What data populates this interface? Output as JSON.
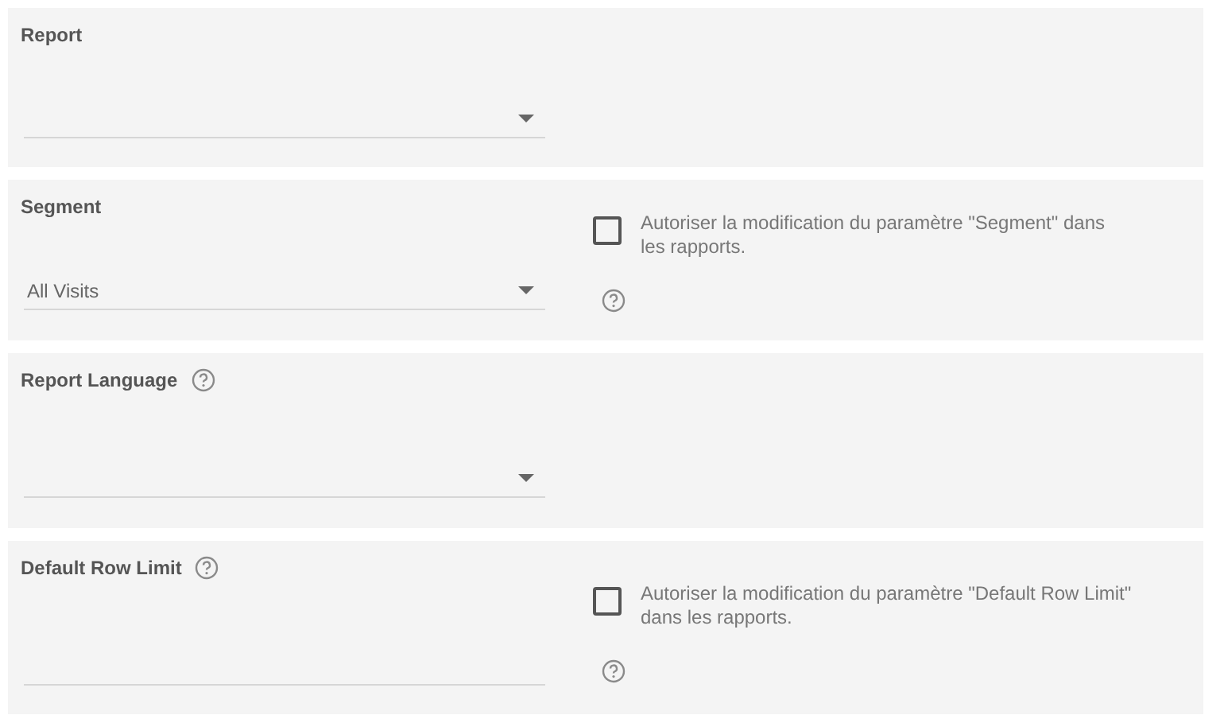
{
  "settings": [
    {
      "label": "Report",
      "label_help": false,
      "kind": "select"
    },
    {
      "label": "Segment",
      "label_help": false,
      "kind": "select",
      "value": "All Visits",
      "override": {
        "checked": false,
        "text": "Autoriser la modification du paramètre \"Segment\" dans les rapports."
      }
    },
    {
      "label": "Report Language",
      "label_help": true,
      "kind": "select"
    },
    {
      "label": "Default Row Limit",
      "label_help": true,
      "kind": "text",
      "override": {
        "checked": false,
        "text": "Autoriser la modification du paramètre \"Default Row Limit\" dans les rapports."
      }
    }
  ]
}
